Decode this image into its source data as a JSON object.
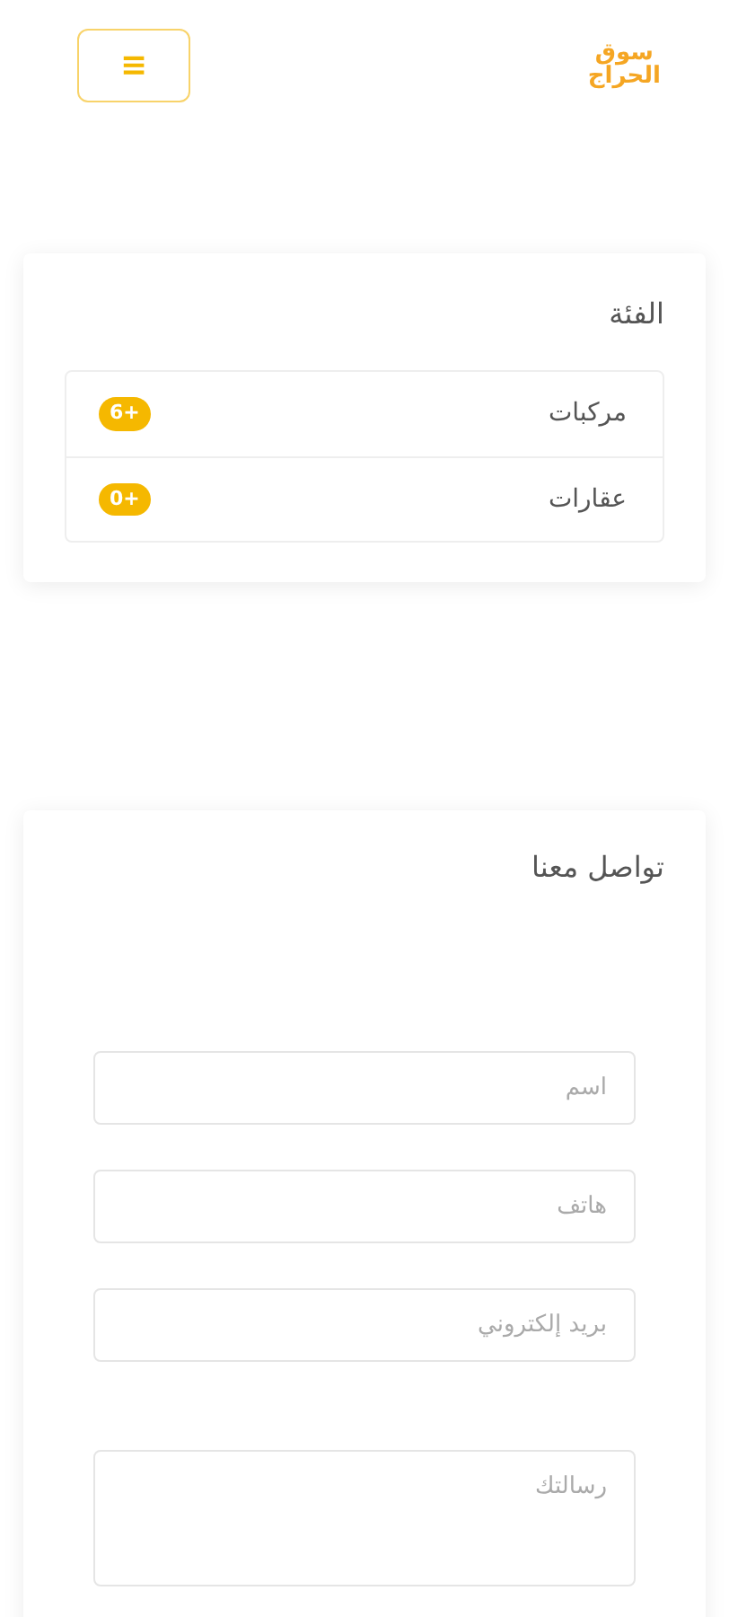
{
  "header": {
    "logo": [
      "سوق",
      "الحراج"
    ],
    "menu_button": "≡"
  },
  "category": {
    "title": "الفئة",
    "items": [
      {
        "label": "مركبات",
        "count": "6+"
      },
      {
        "label": "عقارات",
        "count": "0+"
      }
    ]
  },
  "contact": {
    "title": "تواصل معنا",
    "fields": [
      {
        "kind": "input",
        "placeholder": "اسم"
      },
      {
        "kind": "input",
        "placeholder": "هاتف"
      },
      {
        "kind": "input",
        "placeholder": "بريد إلكتروني"
      },
      {
        "kind": "textarea",
        "placeholder": "رسالتك"
      }
    ]
  }
}
